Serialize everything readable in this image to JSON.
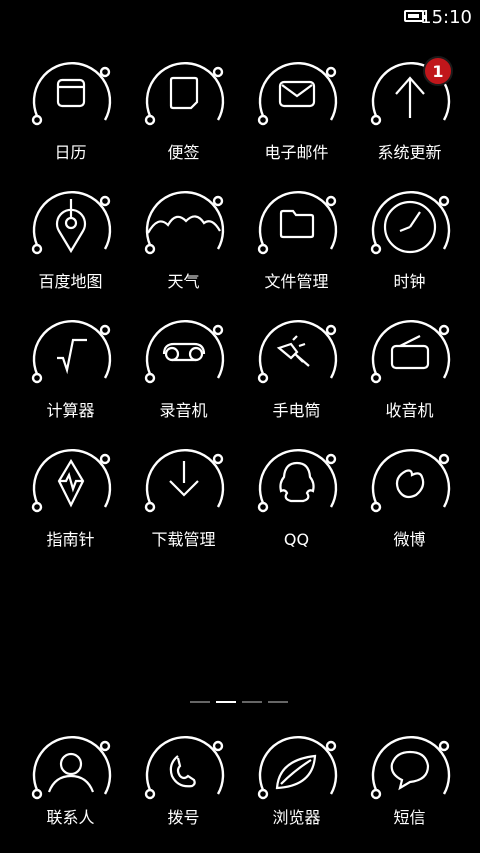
{
  "status_bar": {
    "time": "15:10"
  },
  "apps": [
    {
      "label": "日历",
      "icon": "calendar-icon"
    },
    {
      "label": "便签",
      "icon": "notes-icon"
    },
    {
      "label": "电子邮件",
      "icon": "email-icon"
    },
    {
      "label": "系统更新",
      "icon": "system-update-icon",
      "badge": "1"
    },
    {
      "label": "百度地图",
      "icon": "map-pin-icon"
    },
    {
      "label": "天气",
      "icon": "weather-icon"
    },
    {
      "label": "文件管理",
      "icon": "folder-icon"
    },
    {
      "label": "时钟",
      "icon": "clock-icon"
    },
    {
      "label": "计算器",
      "icon": "calculator-icon"
    },
    {
      "label": "录音机",
      "icon": "recorder-icon"
    },
    {
      "label": "手电筒",
      "icon": "flashlight-icon"
    },
    {
      "label": "收音机",
      "icon": "radio-icon"
    },
    {
      "label": "指南针",
      "icon": "compass-icon"
    },
    {
      "label": "下载管理",
      "icon": "download-icon"
    },
    {
      "label": "QQ",
      "icon": "qq-icon"
    },
    {
      "label": "微博",
      "icon": "weibo-icon"
    }
  ],
  "page_indicator": {
    "pages": 4,
    "current": 2
  },
  "dock": [
    {
      "label": "联系人",
      "icon": "contacts-icon"
    },
    {
      "label": "拨号",
      "icon": "phone-icon"
    },
    {
      "label": "浏览器",
      "icon": "browser-icon"
    },
    {
      "label": "短信",
      "icon": "messages-icon"
    }
  ]
}
